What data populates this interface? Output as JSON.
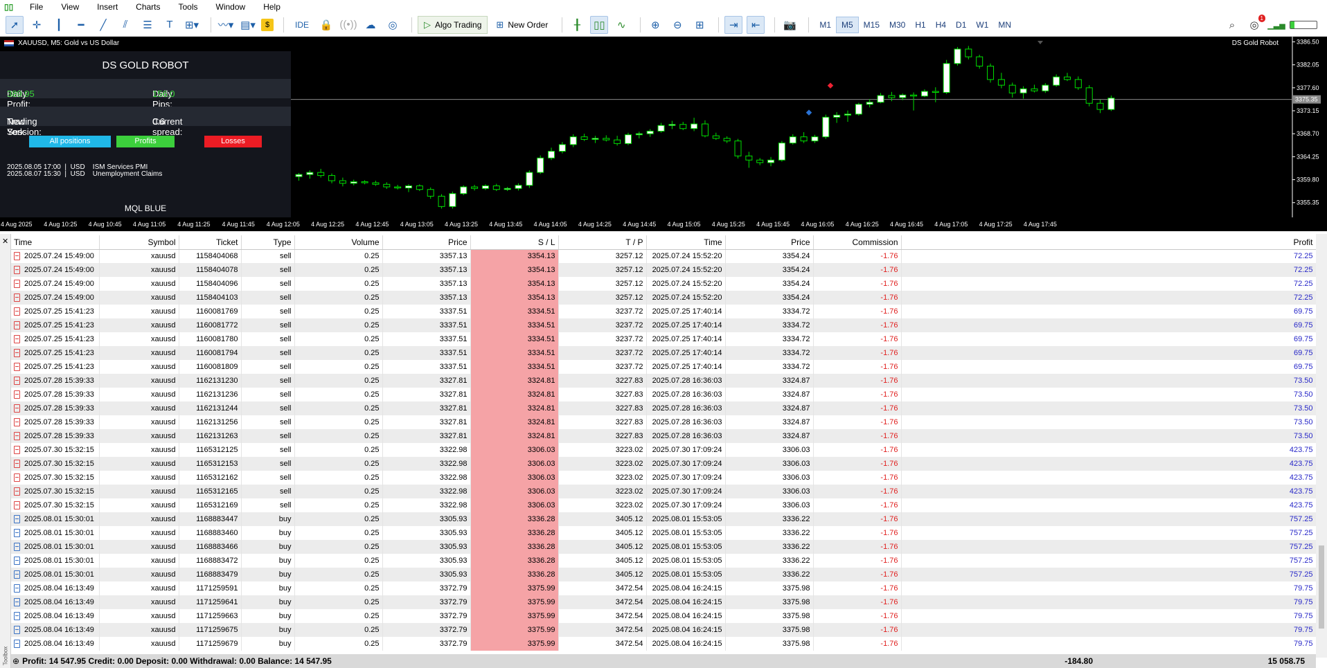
{
  "menu": [
    "File",
    "View",
    "Insert",
    "Charts",
    "Tools",
    "Window",
    "Help"
  ],
  "toolbar": {
    "ide": "IDE",
    "algo_trading": "Algo Trading",
    "new_order": "New Order",
    "timeframes": [
      "M1",
      "M5",
      "M15",
      "M30",
      "H1",
      "H4",
      "D1",
      "W1",
      "MN"
    ],
    "selected_timeframe": "M5",
    "notification_count": "1"
  },
  "chart": {
    "title": "XAUUSD, M5:  Gold vs US Dollar",
    "ea_label": "DS Gold Robot",
    "price_axis": [
      "3386.50",
      "3382.05",
      "3377.60",
      "3373.15",
      "3368.70",
      "3364.25",
      "3359.80",
      "3355.35"
    ],
    "current_price": "3375.35",
    "time_axis": [
      "4 Aug 2025",
      "4 Aug 10:25",
      "4 Aug 10:45",
      "4 Aug 11:05",
      "4 Aug 11:25",
      "4 Aug 11:45",
      "4 Aug 12:05",
      "4 Aug 12:25",
      "4 Aug 12:45",
      "4 Aug 13:05",
      "4 Aug 13:25",
      "4 Aug 13:45",
      "4 Aug 14:05",
      "4 Aug 14:25",
      "4 Aug 14:45",
      "4 Aug 15:05",
      "4 Aug 15:25",
      "4 Aug 15:45",
      "4 Aug 16:05",
      "4 Aug 16:25",
      "4 Aug 16:45",
      "4 Aug 17:05",
      "4 Aug 17:25",
      "4 Aug 17:45"
    ],
    "colors": {
      "bull": "#ffffff",
      "bear": "#000000",
      "wick": "#00e000",
      "bg": "#000000"
    }
  },
  "chart_data": {
    "type": "candlestick",
    "ylim": [
      3352.5,
      3387.5
    ],
    "candles": [
      [
        3360.4,
        3361.1,
        3359.6,
        3360.8
      ],
      [
        3360.8,
        3361.6,
        3360.0,
        3361.2
      ],
      [
        3361.2,
        3361.9,
        3360.2,
        3360.6
      ],
      [
        3360.6,
        3361.0,
        3359.1,
        3359.6
      ],
      [
        3359.6,
        3360.2,
        3358.5,
        3359.1
      ],
      [
        3359.1,
        3359.8,
        3358.7,
        3359.4
      ],
      [
        3359.4,
        3359.7,
        3358.9,
        3359.2
      ],
      [
        3359.2,
        3359.6,
        3358.6,
        3358.9
      ],
      [
        3358.9,
        3359.3,
        3358.0,
        3358.4
      ],
      [
        3358.4,
        3358.8,
        3357.9,
        3358.2
      ],
      [
        3358.2,
        3358.9,
        3357.4,
        3358.6
      ],
      [
        3358.6,
        3358.9,
        3357.6,
        3357.9
      ],
      [
        3357.9,
        3358.3,
        3356.1,
        3356.6
      ],
      [
        3356.6,
        3357.0,
        3354.2,
        3354.6
      ],
      [
        3354.6,
        3357.5,
        3354.2,
        3357.1
      ],
      [
        3357.1,
        3358.7,
        3356.8,
        3358.4
      ],
      [
        3358.4,
        3358.8,
        3357.7,
        3358.1
      ],
      [
        3358.1,
        3358.9,
        3357.8,
        3358.6
      ],
      [
        3358.6,
        3359.0,
        3357.6,
        3357.9
      ],
      [
        3357.9,
        3358.4,
        3357.6,
        3358.1
      ],
      [
        3358.1,
        3359.1,
        3357.7,
        3358.7
      ],
      [
        3358.7,
        3361.6,
        3358.2,
        3361.2
      ],
      [
        3361.2,
        3364.5,
        3360.9,
        3364.0
      ],
      [
        3364.0,
        3366.0,
        3363.6,
        3365.3
      ],
      [
        3365.3,
        3367.1,
        3364.9,
        3366.6
      ],
      [
        3366.6,
        3368.6,
        3366.1,
        3368.1
      ],
      [
        3368.1,
        3368.7,
        3367.3,
        3367.6
      ],
      [
        3367.6,
        3368.3,
        3366.9,
        3367.8
      ],
      [
        3367.8,
        3368.4,
        3367.2,
        3367.5
      ],
      [
        3367.5,
        3368.3,
        3366.4,
        3366.8
      ],
      [
        3366.8,
        3368.9,
        3366.5,
        3368.5
      ],
      [
        3368.5,
        3369.1,
        3367.8,
        3368.7
      ],
      [
        3368.7,
        3369.6,
        3368.1,
        3369.2
      ],
      [
        3369.2,
        3370.8,
        3368.9,
        3370.3
      ],
      [
        3370.3,
        3371.2,
        3369.6,
        3370.5
      ],
      [
        3370.5,
        3371.0,
        3369.4,
        3369.7
      ],
      [
        3369.7,
        3371.8,
        3369.2,
        3370.6
      ],
      [
        3370.6,
        3371.3,
        3368.0,
        3368.3
      ],
      [
        3368.3,
        3368.9,
        3367.5,
        3367.8
      ],
      [
        3367.8,
        3368.2,
        3366.9,
        3367.3
      ],
      [
        3367.3,
        3367.7,
        3363.9,
        3364.4
      ],
      [
        3364.4,
        3365.2,
        3362.1,
        3363.6
      ],
      [
        3363.6,
        3364.0,
        3362.6,
        3363.1
      ],
      [
        3363.1,
        3364.2,
        3362.4,
        3363.6
      ],
      [
        3363.6,
        3367.3,
        3363.3,
        3366.9
      ],
      [
        3366.9,
        3368.6,
        3366.6,
        3368.1
      ],
      [
        3368.1,
        3369.0,
        3366.9,
        3367.3
      ],
      [
        3367.3,
        3368.5,
        3366.9,
        3368.1
      ],
      [
        3368.1,
        3372.4,
        3367.7,
        3371.9
      ],
      [
        3371.9,
        3372.9,
        3370.8,
        3372.3
      ],
      [
        3372.3,
        3373.2,
        3371.0,
        3372.5
      ],
      [
        3372.5,
        3374.7,
        3372.2,
        3374.4
      ],
      [
        3374.4,
        3375.4,
        3373.8,
        3374.8
      ],
      [
        3374.8,
        3376.6,
        3374.6,
        3376.1
      ],
      [
        3376.1,
        3376.8,
        3375.0,
        3375.7
      ],
      [
        3375.7,
        3376.5,
        3375.2,
        3376.2
      ],
      [
        3376.2,
        3376.7,
        3373.2,
        3376.0
      ],
      [
        3376.0,
        3377.3,
        3375.8,
        3376.9
      ],
      [
        3376.9,
        3377.7,
        3374.8,
        3376.7
      ],
      [
        3376.7,
        3383.0,
        3376.4,
        3382.3
      ],
      [
        3382.3,
        3385.5,
        3381.9,
        3385.1
      ],
      [
        3385.1,
        3385.7,
        3383.1,
        3383.6
      ],
      [
        3383.6,
        3384.0,
        3381.3,
        3381.8
      ],
      [
        3381.8,
        3382.3,
        3378.6,
        3379.2
      ],
      [
        3379.2,
        3380.5,
        3377.5,
        3378.1
      ],
      [
        3378.1,
        3378.6,
        3375.7,
        3376.6
      ],
      [
        3376.6,
        3377.9,
        3375.5,
        3377.4
      ],
      [
        3377.4,
        3378.2,
        3376.7,
        3377.0
      ],
      [
        3377.0,
        3378.5,
        3376.6,
        3378.1
      ],
      [
        3378.1,
        3380.2,
        3377.8,
        3379.7
      ],
      [
        3379.7,
        3380.5,
        3378.9,
        3379.2
      ],
      [
        3379.2,
        3379.8,
        3377.2,
        3377.6
      ],
      [
        3377.6,
        3378.1,
        3374.0,
        3374.6
      ],
      [
        3374.6,
        3375.3,
        3372.7,
        3373.4
      ],
      [
        3373.4,
        3376.1,
        3373.1,
        3375.6
      ]
    ]
  },
  "panel": {
    "title": "DS GOLD ROBOT",
    "daily_profit_label": "Daily Profit:",
    "daily_profit": "389.95",
    "daily_pips_label": "Daily Pips:",
    "daily_pips": "156.0",
    "session_label": "Trading Session:",
    "session": "New York",
    "spread_label": "Current spread:",
    "spread": "0.6",
    "btn_all": "All positions",
    "btn_profits": "Profits",
    "btn_losses": "Losses",
    "news": [
      "2025.08.05 17:00  |  USD    ISM Services PMI",
      "2025.08.07 15:30  |  USD    Unemployment Claims"
    ],
    "footer": "MQL BLUE",
    "colors": {
      "all": "#20b8e8",
      "profits": "#3ccf3c",
      "losses": "#ec1c24"
    }
  },
  "table": {
    "headers": [
      "Time",
      "Symbol",
      "Ticket",
      "Type",
      "Volume",
      "Price",
      "S / L",
      "T / P",
      "Time",
      "Price",
      "Commission",
      "Profit"
    ],
    "rows": [
      [
        "2025.07.24 15:49:00",
        "xauusd",
        "1158404068",
        "sell",
        "0.25",
        "3357.13",
        "3354.13",
        "3257.12",
        "2025.07.24 15:52:20",
        "3354.24",
        "-1.76",
        "72.25"
      ],
      [
        "2025.07.24 15:49:00",
        "xauusd",
        "1158404078",
        "sell",
        "0.25",
        "3357.13",
        "3354.13",
        "3257.12",
        "2025.07.24 15:52:20",
        "3354.24",
        "-1.76",
        "72.25"
      ],
      [
        "2025.07.24 15:49:00",
        "xauusd",
        "1158404096",
        "sell",
        "0.25",
        "3357.13",
        "3354.13",
        "3257.12",
        "2025.07.24 15:52:20",
        "3354.24",
        "-1.76",
        "72.25"
      ],
      [
        "2025.07.24 15:49:00",
        "xauusd",
        "1158404103",
        "sell",
        "0.25",
        "3357.13",
        "3354.13",
        "3257.12",
        "2025.07.24 15:52:20",
        "3354.24",
        "-1.76",
        "72.25"
      ],
      [
        "2025.07.25 15:41:23",
        "xauusd",
        "1160081769",
        "sell",
        "0.25",
        "3337.51",
        "3334.51",
        "3237.72",
        "2025.07.25 17:40:14",
        "3334.72",
        "-1.76",
        "69.75"
      ],
      [
        "2025.07.25 15:41:23",
        "xauusd",
        "1160081772",
        "sell",
        "0.25",
        "3337.51",
        "3334.51",
        "3237.72",
        "2025.07.25 17:40:14",
        "3334.72",
        "-1.76",
        "69.75"
      ],
      [
        "2025.07.25 15:41:23",
        "xauusd",
        "1160081780",
        "sell",
        "0.25",
        "3337.51",
        "3334.51",
        "3237.72",
        "2025.07.25 17:40:14",
        "3334.72",
        "-1.76",
        "69.75"
      ],
      [
        "2025.07.25 15:41:23",
        "xauusd",
        "1160081794",
        "sell",
        "0.25",
        "3337.51",
        "3334.51",
        "3237.72",
        "2025.07.25 17:40:14",
        "3334.72",
        "-1.76",
        "69.75"
      ],
      [
        "2025.07.25 15:41:23",
        "xauusd",
        "1160081809",
        "sell",
        "0.25",
        "3337.51",
        "3334.51",
        "3237.72",
        "2025.07.25 17:40:14",
        "3334.72",
        "-1.76",
        "69.75"
      ],
      [
        "2025.07.28 15:39:33",
        "xauusd",
        "1162131230",
        "sell",
        "0.25",
        "3327.81",
        "3324.81",
        "3227.83",
        "2025.07.28 16:36:03",
        "3324.87",
        "-1.76",
        "73.50"
      ],
      [
        "2025.07.28 15:39:33",
        "xauusd",
        "1162131236",
        "sell",
        "0.25",
        "3327.81",
        "3324.81",
        "3227.83",
        "2025.07.28 16:36:03",
        "3324.87",
        "-1.76",
        "73.50"
      ],
      [
        "2025.07.28 15:39:33",
        "xauusd",
        "1162131244",
        "sell",
        "0.25",
        "3327.81",
        "3324.81",
        "3227.83",
        "2025.07.28 16:36:03",
        "3324.87",
        "-1.76",
        "73.50"
      ],
      [
        "2025.07.28 15:39:33",
        "xauusd",
        "1162131256",
        "sell",
        "0.25",
        "3327.81",
        "3324.81",
        "3227.83",
        "2025.07.28 16:36:03",
        "3324.87",
        "-1.76",
        "73.50"
      ],
      [
        "2025.07.28 15:39:33",
        "xauusd",
        "1162131263",
        "sell",
        "0.25",
        "3327.81",
        "3324.81",
        "3227.83",
        "2025.07.28 16:36:03",
        "3324.87",
        "-1.76",
        "73.50"
      ],
      [
        "2025.07.30 15:32:15",
        "xauusd",
        "1165312125",
        "sell",
        "0.25",
        "3322.98",
        "3306.03",
        "3223.02",
        "2025.07.30 17:09:24",
        "3306.03",
        "-1.76",
        "423.75"
      ],
      [
        "2025.07.30 15:32:15",
        "xauusd",
        "1165312153",
        "sell",
        "0.25",
        "3322.98",
        "3306.03",
        "3223.02",
        "2025.07.30 17:09:24",
        "3306.03",
        "-1.76",
        "423.75"
      ],
      [
        "2025.07.30 15:32:15",
        "xauusd",
        "1165312162",
        "sell",
        "0.25",
        "3322.98",
        "3306.03",
        "3223.02",
        "2025.07.30 17:09:24",
        "3306.03",
        "-1.76",
        "423.75"
      ],
      [
        "2025.07.30 15:32:15",
        "xauusd",
        "1165312165",
        "sell",
        "0.25",
        "3322.98",
        "3306.03",
        "3223.02",
        "2025.07.30 17:09:24",
        "3306.03",
        "-1.76",
        "423.75"
      ],
      [
        "2025.07.30 15:32:15",
        "xauusd",
        "1165312169",
        "sell",
        "0.25",
        "3322.98",
        "3306.03",
        "3223.02",
        "2025.07.30 17:09:24",
        "3306.03",
        "-1.76",
        "423.75"
      ],
      [
        "2025.08.01 15:30:01",
        "xauusd",
        "1168883447",
        "buy",
        "0.25",
        "3305.93",
        "3336.28",
        "3405.12",
        "2025.08.01 15:53:05",
        "3336.22",
        "-1.76",
        "757.25"
      ],
      [
        "2025.08.01 15:30:01",
        "xauusd",
        "1168883460",
        "buy",
        "0.25",
        "3305.93",
        "3336.28",
        "3405.12",
        "2025.08.01 15:53:05",
        "3336.22",
        "-1.76",
        "757.25"
      ],
      [
        "2025.08.01 15:30:01",
        "xauusd",
        "1168883466",
        "buy",
        "0.25",
        "3305.93",
        "3336.28",
        "3405.12",
        "2025.08.01 15:53:05",
        "3336.22",
        "-1.76",
        "757.25"
      ],
      [
        "2025.08.01 15:30:01",
        "xauusd",
        "1168883472",
        "buy",
        "0.25",
        "3305.93",
        "3336.28",
        "3405.12",
        "2025.08.01 15:53:05",
        "3336.22",
        "-1.76",
        "757.25"
      ],
      [
        "2025.08.01 15:30:01",
        "xauusd",
        "1168883479",
        "buy",
        "0.25",
        "3305.93",
        "3336.28",
        "3405.12",
        "2025.08.01 15:53:05",
        "3336.22",
        "-1.76",
        "757.25"
      ],
      [
        "2025.08.04 16:13:49",
        "xauusd",
        "1171259591",
        "buy",
        "0.25",
        "3372.79",
        "3375.99",
        "3472.54",
        "2025.08.04 16:24:15",
        "3375.98",
        "-1.76",
        "79.75"
      ],
      [
        "2025.08.04 16:13:49",
        "xauusd",
        "1171259641",
        "buy",
        "0.25",
        "3372.79",
        "3375.99",
        "3472.54",
        "2025.08.04 16:24:15",
        "3375.98",
        "-1.76",
        "79.75"
      ],
      [
        "2025.08.04 16:13:49",
        "xauusd",
        "1171259663",
        "buy",
        "0.25",
        "3372.79",
        "3375.99",
        "3472.54",
        "2025.08.04 16:24:15",
        "3375.98",
        "-1.76",
        "79.75"
      ],
      [
        "2025.08.04 16:13:49",
        "xauusd",
        "1171259675",
        "buy",
        "0.25",
        "3372.79",
        "3375.99",
        "3472.54",
        "2025.08.04 16:24:15",
        "3375.98",
        "-1.76",
        "79.75"
      ],
      [
        "2025.08.04 16:13:49",
        "xauusd",
        "1171259679",
        "buy",
        "0.25",
        "3372.79",
        "3375.99",
        "3472.54",
        "2025.08.04 16:24:15",
        "3375.98",
        "-1.76",
        "79.75"
      ]
    ]
  },
  "summary": {
    "text": "Profit: 14 547.95  Credit: 0.00  Deposit: 0.00  Withdrawal: 0.00  Balance: 14 547.95",
    "commission_total": "-184.80",
    "profit_total": "15 058.75"
  },
  "terminal": {
    "side_label": "Toolbox"
  }
}
